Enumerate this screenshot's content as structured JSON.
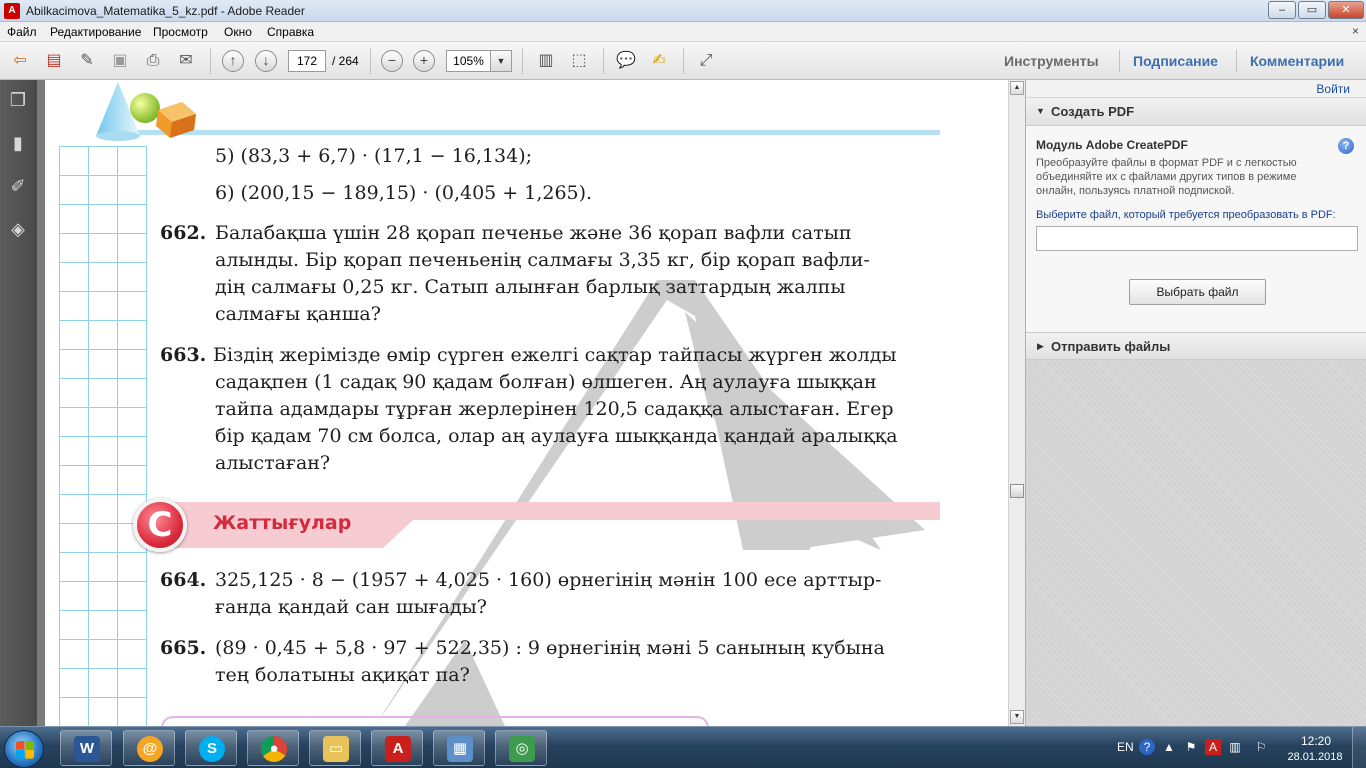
{
  "window": {
    "title": "Abilkacimova_Matematika_5_kz.pdf - Adobe Reader",
    "min_icon": "minimize-icon",
    "max_icon": "maximize-icon",
    "close_icon": "close-icon"
  },
  "menu": {
    "items": [
      "Файл",
      "Редактирование",
      "Просмотр",
      "Окно",
      "Справка"
    ],
    "close_glyph": "×"
  },
  "toolbar": {
    "page_current": "172",
    "page_total": "/ 264",
    "zoom": "105%",
    "tools_label": "Инструменты",
    "sign_label": "Подписание",
    "comment_label": "Комментарии"
  },
  "document": {
    "lines_top": [
      "5) (83,3 + 6,7) · (17,1 − 16,134);",
      "6) (200,15 − 189,15) · (0,405 + 1,265)."
    ],
    "problems": [
      {
        "number": "662.",
        "lines": [
          "Балабақша үшін 28 қорап печенье және 36 қорап вафли сатып",
          "алынды. Бір қорап печеньенің салмағы 3,35 кг, бір қорап вафли-",
          "дің салмағы 0,25 кг. Сатып алынған барлық заттардың жалпы",
          "салмағы қанша?"
        ]
      },
      {
        "number": "663.",
        "lines": [
          "Біздің жерімізде өмір сүрген ежелгі сақтар тайпасы жүрген жолды",
          "садақпен (1 садақ 90 қадам болған) өлшеген. Аң аулауға шыққан",
          "тайпа адамдары тұрған жерлерінен 120,5 садаққа алыстаған. Егер",
          "бір қадам 70 см болса, олар аң аулауға шыққанда қандай аралыққа",
          "алыстаған?"
        ]
      },
      {
        "number": "664.",
        "lines": [
          "325,125 · 8 − (1957 + 4,025 · 160) өрнегінің мәнін 100 есе арттыр-",
          "ғанда қандай сан шығады?"
        ]
      },
      {
        "number": "665.",
        "lines": [
          "(89 · 0,45 + 5,8 · 97 + 522,35) : 9 өрнегінің мәні 5 санының кубына",
          "тең болатыны ақиқат па?"
        ]
      }
    ],
    "section_badge": "C",
    "section_title": "Жаттығулар",
    "watermark_color": "#bdbdbd"
  },
  "right_panel": {
    "signin": "Войти",
    "create_pdf_header": "Создать PDF",
    "module_title": "Модуль Adobe CreatePDF",
    "help_glyph": "?",
    "description": "Преобразуйте файлы в формат PDF и с легкостью объединяйте их с файлами других типов в режиме онлайн, пользуясь платной подпиской.",
    "select_label": "Выберите файл, который требуется преобразовать в PDF:",
    "file_value": "",
    "choose_button": "Выбрать файл",
    "send_files_header": "Отправить файлы"
  },
  "taskbar": {
    "apps": [
      "word-icon",
      "mail-agent-icon",
      "skype-icon",
      "chrome-icon",
      "explorer-icon",
      "adobe-reader-icon",
      "control-panel-icon",
      "network-icon"
    ],
    "lang": "EN",
    "time": "12:20",
    "date": "28.01.2018"
  },
  "colors": {
    "accent_link": "#1a4fa0",
    "section_red": "#d32a3c",
    "grid_blue": "#8fd0ea"
  }
}
